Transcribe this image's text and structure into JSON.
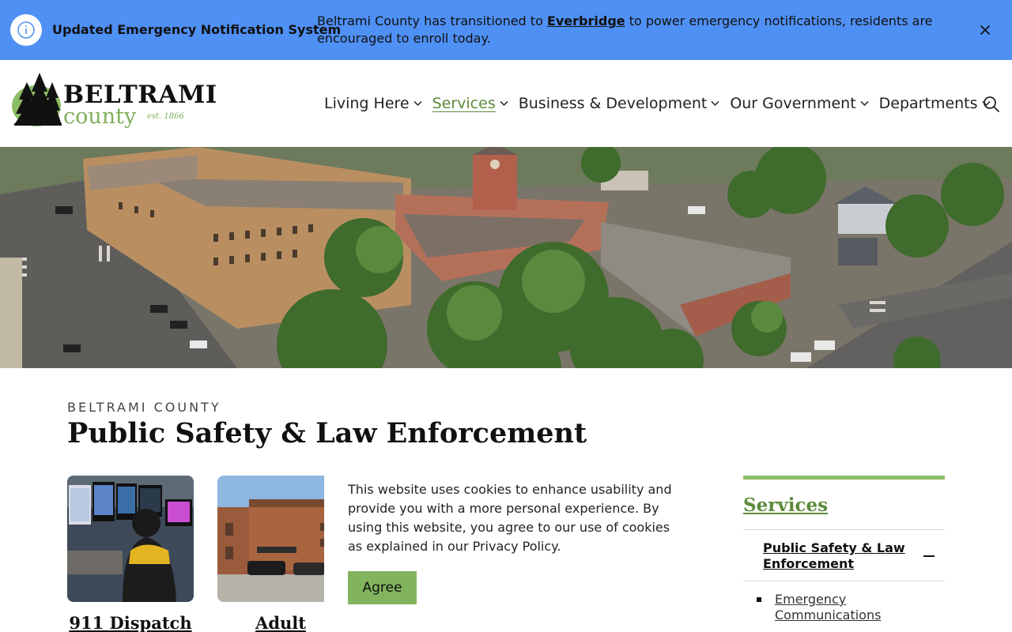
{
  "alert": {
    "title": "Updated Emergency Notification System",
    "message_before": "Beltrami County has transitioned to ",
    "message_link": "Everbridge",
    "message_after": " to power emergency notifications, residents are encouraged to enroll today."
  },
  "logo": {
    "name": "BELTRAMI",
    "county": "county",
    "est": "est. 1866"
  },
  "nav": {
    "items": [
      {
        "label": "Living Here"
      },
      {
        "label": "Services"
      },
      {
        "label": "Business & Development"
      },
      {
        "label": "Our Government"
      },
      {
        "label": "Departments"
      }
    ],
    "active_item": "Services"
  },
  "page": {
    "eyebrow": "BELTRAMI COUNTY",
    "title": "Public Safety & Law Enforcement"
  },
  "cards": [
    {
      "title": "911 Dispatch"
    },
    {
      "title": "Adult"
    }
  ],
  "cookie": {
    "text": "This website uses cookies to enhance usability and provide you with a more personal experience. By using this website, you agree to our use of cookies as explained in our Privacy Policy.",
    "button": "Agree"
  },
  "sidebar": {
    "title": "Services",
    "current": "Public Safety & Law Enforcement",
    "children": [
      {
        "label": "Emergency Communications"
      }
    ]
  },
  "colors": {
    "alert_bg": "#4f90f4",
    "brand_green": "#5c8a3a",
    "accent_green": "#8cbd67",
    "button_green": "#82b35e"
  },
  "icons": {
    "alert": "info-icon",
    "close": "close-icon",
    "chevron": "chevron-down-icon",
    "search": "search-icon",
    "collapse": "minus-icon"
  }
}
